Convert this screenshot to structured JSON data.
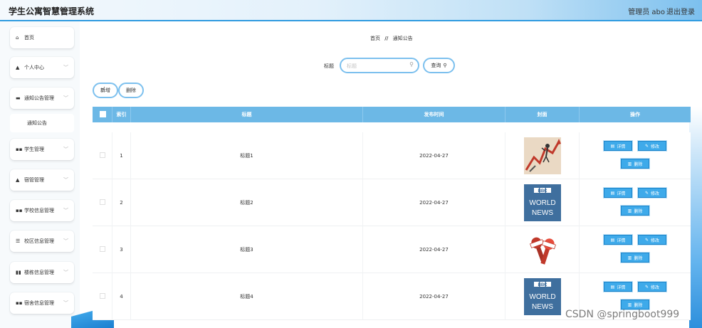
{
  "header": {
    "title": "学生公寓智慧管理系统",
    "admin": "管理员 abo",
    "logout": "退出登录"
  },
  "sidebar": {
    "items": [
      {
        "icon": "home-icon",
        "glyph": "⌂",
        "label": "首页",
        "chevron": false
      },
      {
        "icon": "user-icon",
        "glyph": "▲",
        "label": "个人中心",
        "chevron": true
      },
      {
        "icon": "monitor-icon",
        "glyph": "▬",
        "label": "通知公告管理",
        "chevron": true
      },
      {
        "icon": "grid-icon",
        "glyph": "▪▪",
        "label": "学生管理",
        "chevron": true
      },
      {
        "icon": "user-icon",
        "glyph": "▲",
        "label": "宿管管理",
        "chevron": true
      },
      {
        "icon": "grid-icon",
        "glyph": "▪▪",
        "label": "学校信息管理",
        "chevron": true
      },
      {
        "icon": "sliders-icon",
        "glyph": "☰",
        "label": "校区信息管理",
        "chevron": true
      },
      {
        "icon": "chart-icon",
        "glyph": "▮▮",
        "label": "楼栋信息管理",
        "chevron": true
      },
      {
        "icon": "grid-icon",
        "glyph": "▪▪",
        "label": "宿舍信息管理",
        "chevron": true
      }
    ],
    "sub_item": "通知公告"
  },
  "breadcrumb": {
    "home": "首页",
    "sep": "//",
    "current": "通知公告"
  },
  "search": {
    "label": "标题",
    "placeholder": "标题",
    "value": "",
    "button": "查询"
  },
  "toolbar": {
    "add": "新增",
    "delete": "删除"
  },
  "table": {
    "columns": [
      "索引",
      "标题",
      "发布时间",
      "封面",
      "操作"
    ],
    "rows": [
      {
        "index": "1",
        "title": "标题1",
        "date": "2022-04-27",
        "cover": "stock-chart-image"
      },
      {
        "index": "2",
        "title": "标题2",
        "date": "2022-04-27",
        "cover": "bbc-world-news-image"
      },
      {
        "index": "3",
        "title": "标题3",
        "date": "2022-04-27",
        "cover": "microphones-image"
      },
      {
        "index": "4",
        "title": "标题4",
        "date": "2022-04-27",
        "cover": "bbc-world-news-image"
      }
    ],
    "actions": {
      "detail": "详情",
      "edit": "修改",
      "delete": "删除"
    }
  },
  "bbc": {
    "logo": "BBC",
    "line1": "WORLD",
    "line2": "NEWS"
  },
  "watermark": "CSDN @springboot999",
  "colors": {
    "accent": "#2f9be0",
    "table_header": "#6cb8e6",
    "action_button": "#3eaaea"
  }
}
